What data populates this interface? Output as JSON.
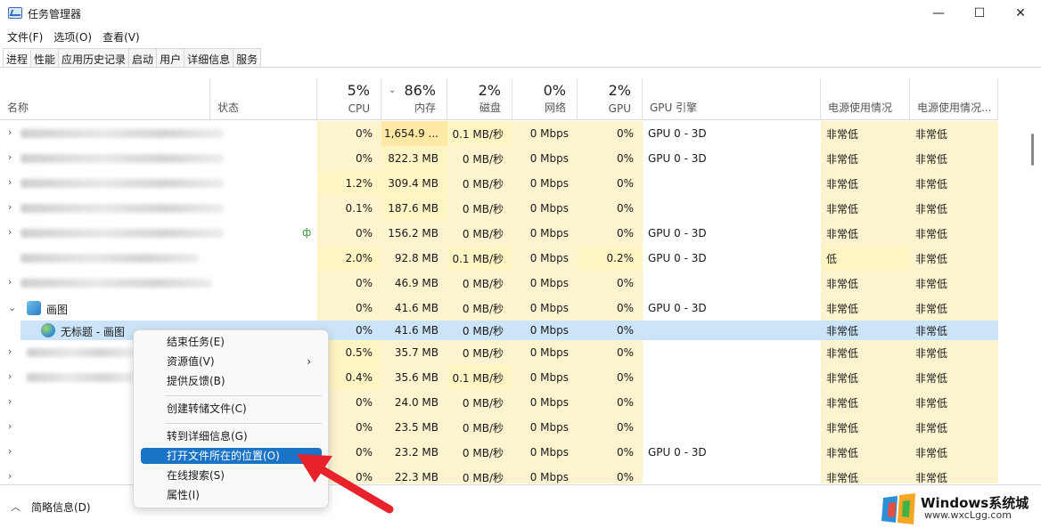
{
  "window": {
    "title": "任务管理器"
  },
  "menu": [
    "文件(F)",
    "选项(O)",
    "查看(V)"
  ],
  "tabs": [
    "进程",
    "性能",
    "应用历史记录",
    "启动",
    "用户",
    "详细信息",
    "服务"
  ],
  "columns": {
    "name": "名称",
    "status": "状态",
    "cpu": {
      "pct": "5%",
      "label": "CPU"
    },
    "mem": {
      "pct": "86%",
      "label": "内存"
    },
    "disk": {
      "pct": "2%",
      "label": "磁盘"
    },
    "net": {
      "pct": "0%",
      "label": "网络"
    },
    "gpu": {
      "pct": "2%",
      "label": "GPU"
    },
    "gpu_engine": "GPU 引擎",
    "power": "电源使用情况",
    "power_trend": "电源使用情况..."
  },
  "rows": [
    {
      "cpu": "0%",
      "mem": "1,654.9 ...",
      "disk": "0.1 MB/秒",
      "net": "0 Mbps",
      "gpu": "0%",
      "engine": "GPU 0 - 3D",
      "power": "非常低",
      "trend": "非常低"
    },
    {
      "cpu": "0%",
      "mem": "822.3 MB",
      "disk": "0 MB/秒",
      "net": "0 Mbps",
      "gpu": "0%",
      "engine": "GPU 0 - 3D",
      "power": "非常低",
      "trend": "非常低"
    },
    {
      "cpu": "1.2%",
      "mem": "309.4 MB",
      "disk": "0 MB/秒",
      "net": "0 Mbps",
      "gpu": "0%",
      "engine": "",
      "power": "非常低",
      "trend": "非常低"
    },
    {
      "cpu": "0.1%",
      "mem": "187.6 MB",
      "disk": "0 MB/秒",
      "net": "0 Mbps",
      "gpu": "0%",
      "engine": "",
      "power": "非常低",
      "trend": "非常低"
    },
    {
      "cpu": "0%",
      "mem": "156.2 MB",
      "disk": "0 MB/秒",
      "net": "0 Mbps",
      "gpu": "0%",
      "engine": "GPU 0 - 3D",
      "power": "非常低",
      "trend": "非常低"
    },
    {
      "cpu": "2.0%",
      "mem": "92.8 MB",
      "disk": "0.1 MB/秒",
      "net": "0 Mbps",
      "gpu": "0.2%",
      "engine": "GPU 0 - 3D",
      "power": "低",
      "trend": "非常低"
    },
    {
      "cpu": "0%",
      "mem": "46.9 MB",
      "disk": "0 MB/秒",
      "net": "0 Mbps",
      "gpu": "0%",
      "engine": "",
      "power": "非常低",
      "trend": "非常低"
    },
    {
      "name": "画图",
      "cpu": "0%",
      "mem": "41.6 MB",
      "disk": "0 MB/秒",
      "net": "0 Mbps",
      "gpu": "0%",
      "engine": "GPU 0 - 3D",
      "power": "非常低",
      "trend": "非常低"
    },
    {
      "name": "无标题 - 画图",
      "cpu": "0%",
      "mem": "41.6 MB",
      "disk": "0 MB/秒",
      "net": "0 Mbps",
      "gpu": "0%",
      "engine": "",
      "power": "非常低",
      "trend": "非常低"
    },
    {
      "cpu": "0.5%",
      "mem": "35.7 MB",
      "disk": "0 MB/秒",
      "net": "0 Mbps",
      "gpu": "0%",
      "engine": "",
      "power": "非常低",
      "trend": "非常低"
    },
    {
      "cpu": "0.4%",
      "mem": "35.6 MB",
      "disk": "0.1 MB/秒",
      "net": "0 Mbps",
      "gpu": "0%",
      "engine": "",
      "power": "非常低",
      "trend": "非常低"
    },
    {
      "cpu": "0%",
      "mem": "24.0 MB",
      "disk": "0 MB/秒",
      "net": "0 Mbps",
      "gpu": "0%",
      "engine": "",
      "power": "非常低",
      "trend": "非常低"
    },
    {
      "cpu": "0%",
      "mem": "23.5 MB",
      "disk": "0 MB/秒",
      "net": "0 Mbps",
      "gpu": "0%",
      "engine": "",
      "power": "非常低",
      "trend": "非常低"
    },
    {
      "cpu": "0%",
      "mem": "23.2 MB",
      "disk": "0 MB/秒",
      "net": "0 Mbps",
      "gpu": "0%",
      "engine": "GPU 0 - 3D",
      "power": "非常低",
      "trend": "非常低"
    },
    {
      "cpu": "0%",
      "mem": "22.3 MB",
      "disk": "0 MB/秒",
      "net": "0 Mbps",
      "gpu": "0%",
      "engine": "",
      "power": "非常低",
      "trend": "非常低"
    }
  ],
  "context_menu": [
    "结束任务(E)",
    "资源值(V)",
    "提供反馈(B)",
    "创建转储文件(C)",
    "转到详细信息(G)",
    "打开文件所在的位置(O)",
    "在线搜索(S)",
    "属性(I)"
  ],
  "footer": {
    "label": "简略信息(D)"
  },
  "watermark": {
    "title": "Windows系统城",
    "url": "www.wxcLgg.com"
  },
  "colors": {
    "accent": "#1a73c7",
    "selected_row": "#cce4f7",
    "heat_light": "#fff4c4",
    "heat_mid": "#ffe9a5",
    "arrow": "#e8222a"
  }
}
